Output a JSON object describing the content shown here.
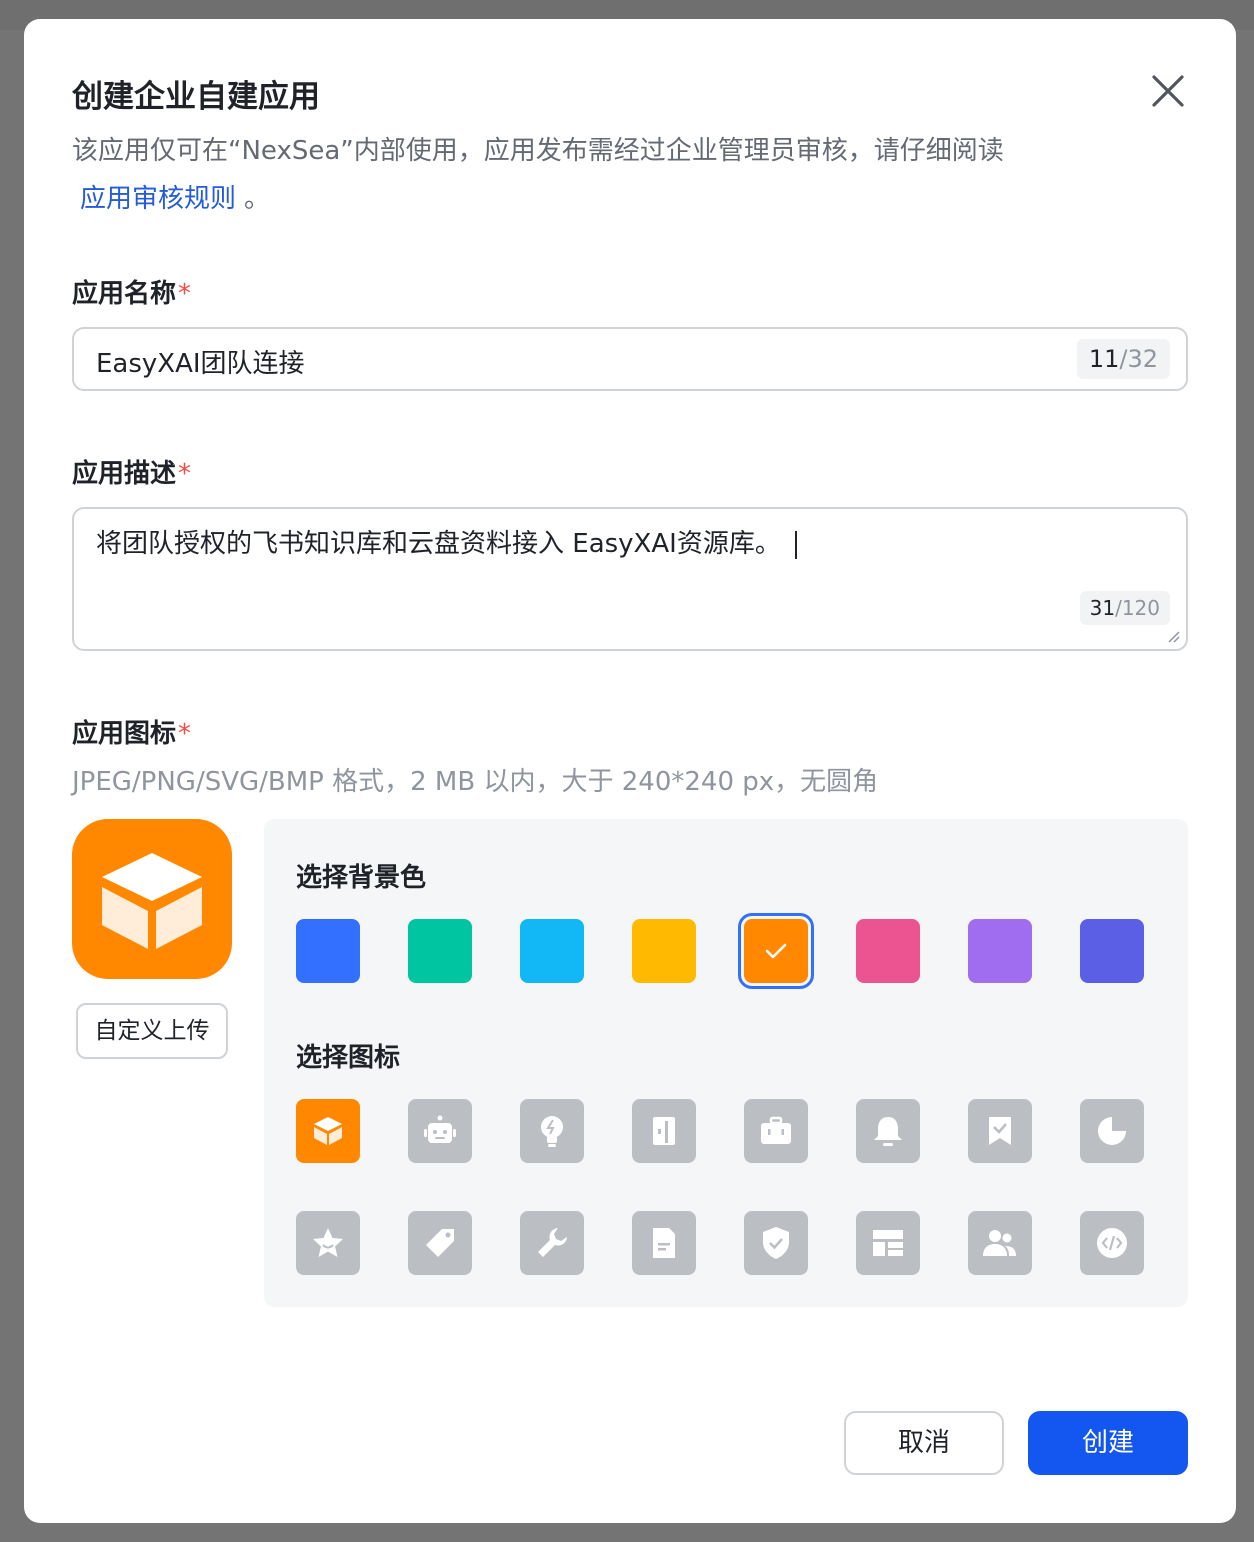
{
  "dialog": {
    "title": "创建企业自建应用",
    "description": "该应用仅可在“NexSea”内部使用，应用发布需经过企业管理员审核，请仔细阅读",
    "rules_link": "应用审核规则",
    "description_end": "。"
  },
  "name_field": {
    "label": "应用名称",
    "required_mark": "*",
    "value": "EasyXAI团队连接",
    "count_current": "11",
    "count_max": "/32"
  },
  "desc_field": {
    "label": "应用描述",
    "required_mark": "*",
    "value": "将团队授权的飞书知识库和云盘资料接入 EasyXAI资源库。",
    "count_current": "31",
    "count_max": "/120"
  },
  "icon_field": {
    "label": "应用图标",
    "required_mark": "*",
    "hint": "JPEG/PNG/SVG/BMP 格式，2 MB 以内，大于 240*240 px，无圆角",
    "upload_label": "自定义上传",
    "preview_color": "#ff8800"
  },
  "picker": {
    "bg_title": "选择背景色",
    "icon_title": "选择图标",
    "colors": [
      {
        "name": "blue",
        "hex": "#3370ff"
      },
      {
        "name": "teal",
        "hex": "#00c5a1"
      },
      {
        "name": "cyan",
        "hex": "#12b7f5"
      },
      {
        "name": "yellow",
        "hex": "#ffba00"
      },
      {
        "name": "orange",
        "hex": "#ff8800",
        "selected": true
      },
      {
        "name": "pink",
        "hex": "#eb5391"
      },
      {
        "name": "purple",
        "hex": "#a06cf0"
      },
      {
        "name": "indigo",
        "hex": "#5b5fe6"
      }
    ],
    "icons": [
      "cube-icon",
      "robot-icon",
      "lightbulb-icon",
      "door-icon",
      "briefcase-icon",
      "bell-icon",
      "bookmark-check-icon",
      "pie-chart-icon",
      "star-icon",
      "tag-icon",
      "wrench-icon",
      "document-icon",
      "shield-check-icon",
      "layout-icon",
      "users-icon",
      "code-icon"
    ],
    "selected_icon": "cube-icon"
  },
  "footer": {
    "cancel_label": "取消",
    "create_label": "创建"
  },
  "colors": {
    "primary": "#1456f0",
    "link": "#245bdb",
    "required": "#f54a45",
    "tile_gray": "#bbbfc4"
  }
}
